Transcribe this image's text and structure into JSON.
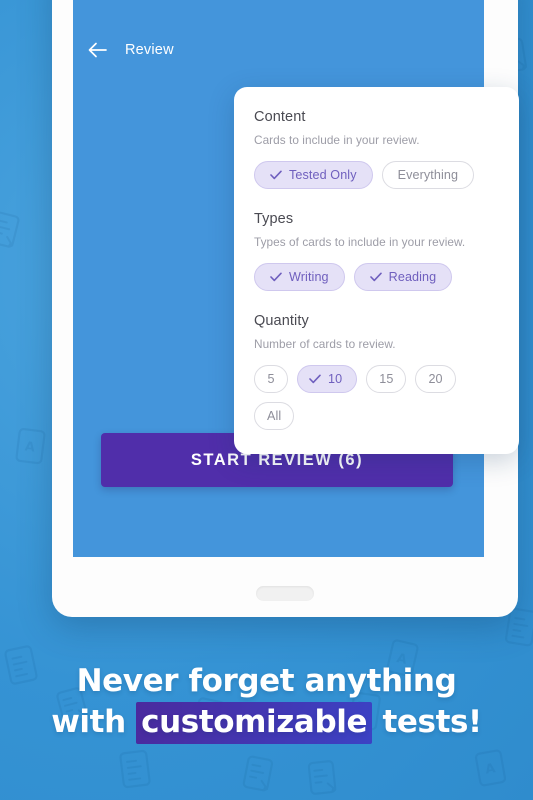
{
  "theme": {
    "background_blue": "#3a9bd9",
    "screen_blue": "#4495db",
    "accent_purple": "#502eaa",
    "pill_selected_bg": "#e5e1f7",
    "pill_selected_text": "#6f5fbe",
    "tablet_frame": "#fdfdfd"
  },
  "app": {
    "back_icon": "arrow-left-icon",
    "title": "Review"
  },
  "settings_card": {
    "sections": [
      {
        "key": "content",
        "title": "Content",
        "subtitle": "Cards to include in your review.",
        "options": [
          {
            "label": "Tested Only",
            "selected": true
          },
          {
            "label": "Everything",
            "selected": false
          }
        ]
      },
      {
        "key": "types",
        "title": "Types",
        "subtitle": "Types of cards to include in your review.",
        "options": [
          {
            "label": "Writing",
            "selected": true
          },
          {
            "label": "Reading",
            "selected": true
          }
        ]
      },
      {
        "key": "quantity",
        "title": "Quantity",
        "subtitle": "Number of cards to review.",
        "options": [
          {
            "label": "5",
            "selected": false
          },
          {
            "label": "10",
            "selected": true
          },
          {
            "label": "15",
            "selected": false
          },
          {
            "label": "20",
            "selected": false
          },
          {
            "label": "All",
            "selected": false
          }
        ]
      }
    ]
  },
  "start_button": {
    "label": "START REVIEW (6)",
    "count": 6
  },
  "tagline": {
    "line1": "Never forget anything",
    "line2_prefix": "with ",
    "line2_highlight": "customizable",
    "line2_suffix": " tests!"
  }
}
